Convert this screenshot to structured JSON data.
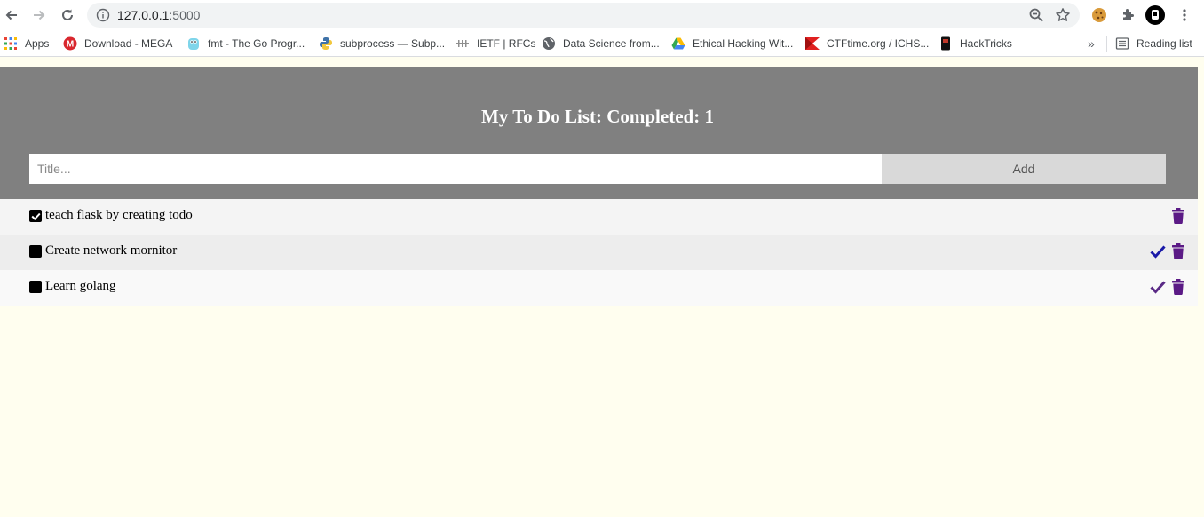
{
  "browser": {
    "url_host": "127.0.0.1",
    "url_port": ":5000",
    "bookmarks": [
      {
        "label": "Apps",
        "icon": "apps-grid-icon"
      },
      {
        "label": "Download - MEGA",
        "icon": "mega-icon"
      },
      {
        "label": "fmt - The Go Progr...",
        "icon": "go-gopher-icon"
      },
      {
        "label": "subprocess — Subp...",
        "icon": "python-icon"
      },
      {
        "label": "IETF | RFCs",
        "icon": "ietf-icon"
      },
      {
        "label": "Data Science from...",
        "icon": "globe-icon"
      },
      {
        "label": "Ethical Hacking Wit...",
        "icon": "google-drive-icon"
      },
      {
        "label": "CTFtime.org / ICHS...",
        "icon": "ctftime-icon"
      },
      {
        "label": "HackTricks",
        "icon": "hacktricks-icon"
      }
    ],
    "overflow_label": "»",
    "reading_list_label": "Reading list"
  },
  "app": {
    "heading": "My To Do List: Completed: 1",
    "input_placeholder": "Title...",
    "add_label": "Add"
  },
  "todos": [
    {
      "text": "teach flask by creating todo",
      "completed": true
    },
    {
      "text": "Create network mornitor",
      "completed": false
    },
    {
      "text": "Learn golang",
      "completed": false
    }
  ],
  "colors": {
    "header_bg": "#808080",
    "check_icon": "#1a1aa8",
    "check_icon_alt": "#5a2a86",
    "trash_icon": "#5b1a86",
    "page_bg": "#fffeef"
  }
}
